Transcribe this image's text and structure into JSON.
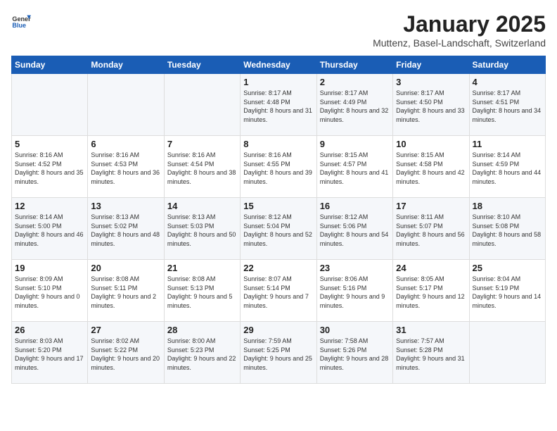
{
  "header": {
    "logo_general": "General",
    "logo_blue": "Blue",
    "title": "January 2025",
    "subtitle": "Muttenz, Basel-Landschaft, Switzerland"
  },
  "days_of_week": [
    "Sunday",
    "Monday",
    "Tuesday",
    "Wednesday",
    "Thursday",
    "Friday",
    "Saturday"
  ],
  "weeks": [
    [
      {
        "day": "",
        "info": ""
      },
      {
        "day": "",
        "info": ""
      },
      {
        "day": "",
        "info": ""
      },
      {
        "day": "1",
        "info": "Sunrise: 8:17 AM\nSunset: 4:48 PM\nDaylight: 8 hours and 31 minutes."
      },
      {
        "day": "2",
        "info": "Sunrise: 8:17 AM\nSunset: 4:49 PM\nDaylight: 8 hours and 32 minutes."
      },
      {
        "day": "3",
        "info": "Sunrise: 8:17 AM\nSunset: 4:50 PM\nDaylight: 8 hours and 33 minutes."
      },
      {
        "day": "4",
        "info": "Sunrise: 8:17 AM\nSunset: 4:51 PM\nDaylight: 8 hours and 34 minutes."
      }
    ],
    [
      {
        "day": "5",
        "info": "Sunrise: 8:16 AM\nSunset: 4:52 PM\nDaylight: 8 hours and 35 minutes."
      },
      {
        "day": "6",
        "info": "Sunrise: 8:16 AM\nSunset: 4:53 PM\nDaylight: 8 hours and 36 minutes."
      },
      {
        "day": "7",
        "info": "Sunrise: 8:16 AM\nSunset: 4:54 PM\nDaylight: 8 hours and 38 minutes."
      },
      {
        "day": "8",
        "info": "Sunrise: 8:16 AM\nSunset: 4:55 PM\nDaylight: 8 hours and 39 minutes."
      },
      {
        "day": "9",
        "info": "Sunrise: 8:15 AM\nSunset: 4:57 PM\nDaylight: 8 hours and 41 minutes."
      },
      {
        "day": "10",
        "info": "Sunrise: 8:15 AM\nSunset: 4:58 PM\nDaylight: 8 hours and 42 minutes."
      },
      {
        "day": "11",
        "info": "Sunrise: 8:14 AM\nSunset: 4:59 PM\nDaylight: 8 hours and 44 minutes."
      }
    ],
    [
      {
        "day": "12",
        "info": "Sunrise: 8:14 AM\nSunset: 5:00 PM\nDaylight: 8 hours and 46 minutes."
      },
      {
        "day": "13",
        "info": "Sunrise: 8:13 AM\nSunset: 5:02 PM\nDaylight: 8 hours and 48 minutes."
      },
      {
        "day": "14",
        "info": "Sunrise: 8:13 AM\nSunset: 5:03 PM\nDaylight: 8 hours and 50 minutes."
      },
      {
        "day": "15",
        "info": "Sunrise: 8:12 AM\nSunset: 5:04 PM\nDaylight: 8 hours and 52 minutes."
      },
      {
        "day": "16",
        "info": "Sunrise: 8:12 AM\nSunset: 5:06 PM\nDaylight: 8 hours and 54 minutes."
      },
      {
        "day": "17",
        "info": "Sunrise: 8:11 AM\nSunset: 5:07 PM\nDaylight: 8 hours and 56 minutes."
      },
      {
        "day": "18",
        "info": "Sunrise: 8:10 AM\nSunset: 5:08 PM\nDaylight: 8 hours and 58 minutes."
      }
    ],
    [
      {
        "day": "19",
        "info": "Sunrise: 8:09 AM\nSunset: 5:10 PM\nDaylight: 9 hours and 0 minutes."
      },
      {
        "day": "20",
        "info": "Sunrise: 8:08 AM\nSunset: 5:11 PM\nDaylight: 9 hours and 2 minutes."
      },
      {
        "day": "21",
        "info": "Sunrise: 8:08 AM\nSunset: 5:13 PM\nDaylight: 9 hours and 5 minutes."
      },
      {
        "day": "22",
        "info": "Sunrise: 8:07 AM\nSunset: 5:14 PM\nDaylight: 9 hours and 7 minutes."
      },
      {
        "day": "23",
        "info": "Sunrise: 8:06 AM\nSunset: 5:16 PM\nDaylight: 9 hours and 9 minutes."
      },
      {
        "day": "24",
        "info": "Sunrise: 8:05 AM\nSunset: 5:17 PM\nDaylight: 9 hours and 12 minutes."
      },
      {
        "day": "25",
        "info": "Sunrise: 8:04 AM\nSunset: 5:19 PM\nDaylight: 9 hours and 14 minutes."
      }
    ],
    [
      {
        "day": "26",
        "info": "Sunrise: 8:03 AM\nSunset: 5:20 PM\nDaylight: 9 hours and 17 minutes."
      },
      {
        "day": "27",
        "info": "Sunrise: 8:02 AM\nSunset: 5:22 PM\nDaylight: 9 hours and 20 minutes."
      },
      {
        "day": "28",
        "info": "Sunrise: 8:00 AM\nSunset: 5:23 PM\nDaylight: 9 hours and 22 minutes."
      },
      {
        "day": "29",
        "info": "Sunrise: 7:59 AM\nSunset: 5:25 PM\nDaylight: 9 hours and 25 minutes."
      },
      {
        "day": "30",
        "info": "Sunrise: 7:58 AM\nSunset: 5:26 PM\nDaylight: 9 hours and 28 minutes."
      },
      {
        "day": "31",
        "info": "Sunrise: 7:57 AM\nSunset: 5:28 PM\nDaylight: 9 hours and 31 minutes."
      },
      {
        "day": "",
        "info": ""
      }
    ]
  ]
}
